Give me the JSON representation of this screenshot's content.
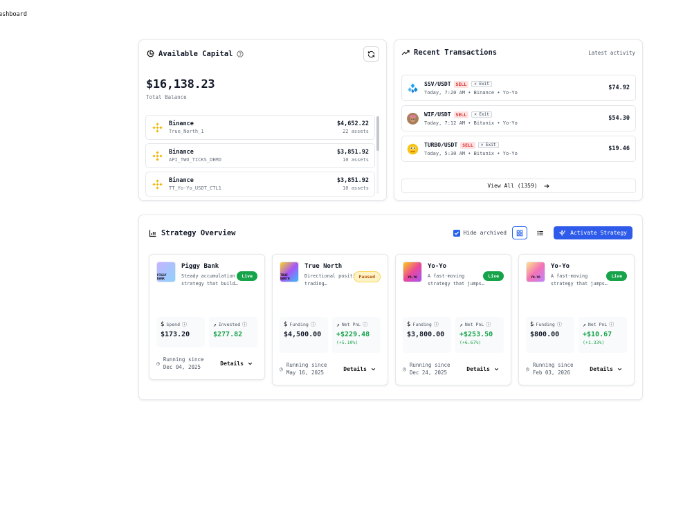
{
  "page": {
    "label": "ashboard"
  },
  "capital": {
    "title": "Available Capital",
    "balance": "$16,138.23",
    "balance_label": "Total Balance",
    "accounts": [
      {
        "exchange": "Binance",
        "account": "True_North_1",
        "amount": "$4,652.22",
        "assets": "22 assets"
      },
      {
        "exchange": "Binance",
        "account": "API_TWO_TICKS_DEMO",
        "amount": "$3,851.92",
        "assets": "10 assets"
      },
      {
        "exchange": "Binance",
        "account": "TT_Yo-Yo_USDT_CTL1",
        "amount": "$3,851.92",
        "assets": "10 assets"
      }
    ]
  },
  "transactions": {
    "title": "Recent Transactions",
    "subtitle": "Latest activity",
    "items": [
      {
        "pair": "SSV/USDT",
        "side": "SELL",
        "tag": "× Exit",
        "meta": "Today, 7:20 AM • Binance • Yo-Yo",
        "amount": "$74.92"
      },
      {
        "pair": "WIF/USDT",
        "side": "SELL",
        "tag": "× Exit",
        "meta": "Today, 7:12 AM • Bitunix • Yo-Yo",
        "amount": "$54.30"
      },
      {
        "pair": "TURBO/USDT",
        "side": "SELL",
        "tag": "× Exit",
        "meta": "Today, 5:30 AM • Bitunix • Yo-Yo",
        "amount": "$19.46"
      }
    ],
    "view_all": "View All (1359)"
  },
  "strategy": {
    "title": "Strategy Overview",
    "hide_archived": "Hide archived",
    "activate": "Activate Strategy",
    "cards": [
      {
        "name": "Piggy Bank",
        "status": "Live",
        "thumb": "PIGGY BANK",
        "desc": "Steady accumulation strategy that build…",
        "m1_label": "Spend",
        "m1_value": "$173.20",
        "m2_label": "Invested",
        "m2_value": "$277.82",
        "m2_pct": "",
        "since_label": "Running since",
        "since_date": "Dec 04, 2025",
        "details": "Details"
      },
      {
        "name": "True North",
        "status": "Paused",
        "thumb": "TRUE NORTH",
        "desc": "Directional position-trading…",
        "m1_label": "Funding",
        "m1_value": "$4,500.00",
        "m2_label": "Net PnL",
        "m2_value": "+$229.48",
        "m2_pct": "(+5.10%)",
        "since_label": "Running since",
        "since_date": "May 16, 2025",
        "details": "Details"
      },
      {
        "name": "Yo-Yo",
        "status": "Live",
        "thumb": "YO-YO",
        "desc": "A fast-moving strategy that jumps…",
        "m1_label": "Funding",
        "m1_value": "$3,800.00",
        "m2_label": "Net PnL",
        "m2_value": "+$253.50",
        "m2_pct": "(+6.67%)",
        "since_label": "Running since",
        "since_date": "Dec 24, 2025",
        "details": "Details"
      },
      {
        "name": "Yo-Yo",
        "status": "Live",
        "thumb": "YO-YO",
        "desc": "A fast-moving strategy that jumps…",
        "m1_label": "Funding",
        "m1_value": "$800.00",
        "m2_label": "Net PnL",
        "m2_value": "+$10.67",
        "m2_pct": "(+1.33%)",
        "since_label": "Running since",
        "since_date": "Feb 03, 2026",
        "details": "Details"
      }
    ]
  },
  "colors": {
    "accent": "#2f5bea",
    "live": "#16a34a",
    "sell": "#dc2626",
    "binance": "#f0b90b"
  }
}
